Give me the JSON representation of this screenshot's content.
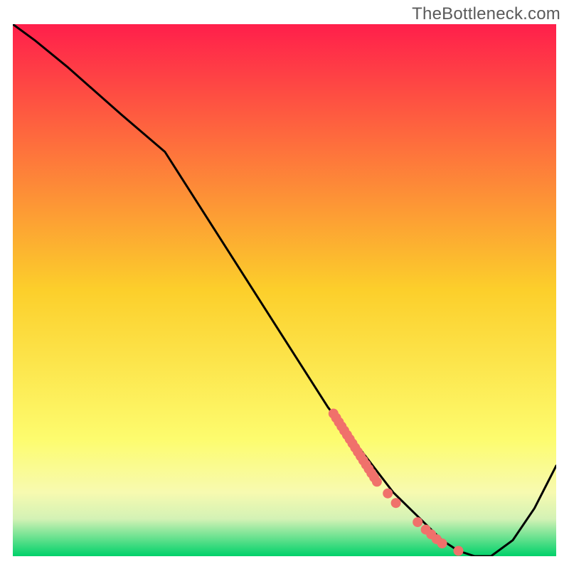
{
  "watermark": "TheBottleneck.com",
  "chart_data": {
    "type": "line",
    "title": "",
    "xlabel": "",
    "ylabel": "",
    "xlim": [
      0,
      100
    ],
    "ylim": [
      0,
      100
    ],
    "grid": false,
    "legend": false,
    "background_gradient": {
      "stops": [
        {
          "pos": 0.0,
          "color": "#ff1f4b"
        },
        {
          "pos": 0.5,
          "color": "#fccf2b"
        },
        {
          "pos": 0.78,
          "color": "#fdfc6e"
        },
        {
          "pos": 0.88,
          "color": "#f7fab0"
        },
        {
          "pos": 0.93,
          "color": "#d3f2b5"
        },
        {
          "pos": 1.0,
          "color": "#00d16a"
        }
      ]
    },
    "series": [
      {
        "name": "main-curve",
        "type": "line",
        "color": "#000000",
        "x": [
          0,
          4,
          10,
          20,
          28,
          38,
          48,
          58,
          64,
          70,
          75,
          79,
          82,
          85,
          88,
          92,
          96,
          100
        ],
        "y": [
          100,
          97,
          92,
          83,
          76,
          60,
          44,
          28,
          20,
          12,
          7,
          3,
          1,
          0,
          0,
          3,
          9,
          17
        ]
      },
      {
        "name": "highlight-cluster",
        "type": "scatter",
        "color": "#f0716b",
        "x": [
          59.0,
          59.5,
          60.0,
          60.5,
          61.0,
          61.5,
          62.0,
          62.5,
          63.0,
          63.5,
          64.0,
          64.5,
          65.0,
          65.5,
          66.0,
          66.5,
          67.0,
          69.0,
          70.5,
          74.5,
          76.0,
          77.0,
          78.0,
          79.0,
          82.0
        ],
        "y": [
          26.8,
          26.0,
          25.2,
          24.4,
          23.6,
          22.8,
          22.0,
          21.2,
          20.4,
          19.6,
          18.8,
          18.0,
          17.2,
          16.4,
          15.6,
          14.8,
          14.0,
          11.8,
          10.0,
          6.4,
          5.0,
          4.1,
          3.2,
          2.4,
          1.0
        ]
      }
    ]
  }
}
